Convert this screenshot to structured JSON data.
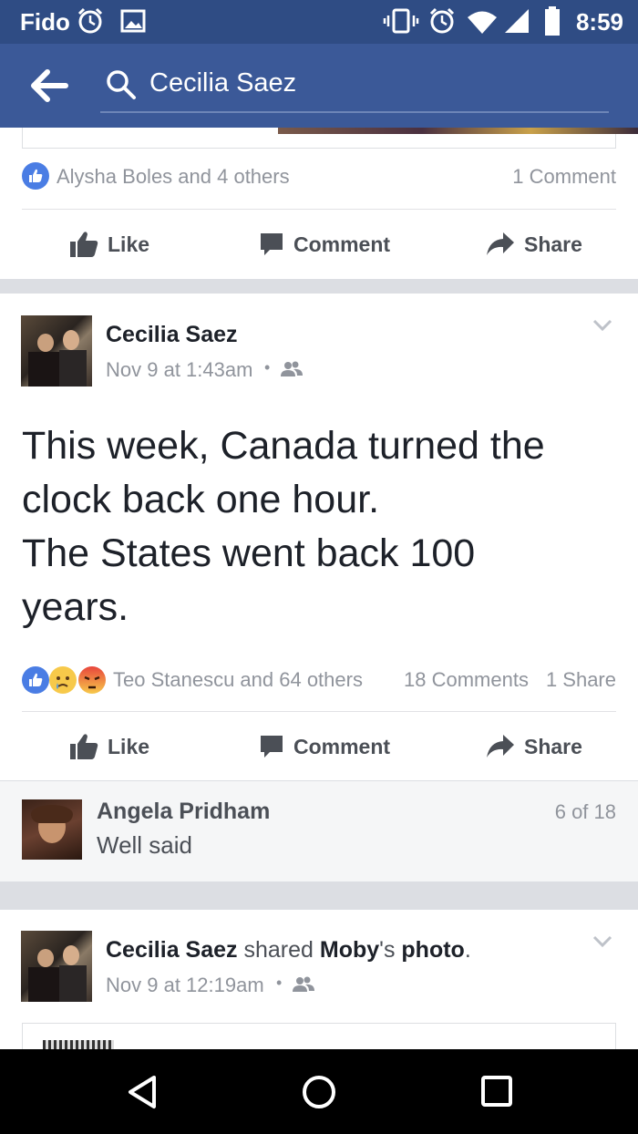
{
  "status_bar": {
    "carrier": "Fido",
    "time": "8:59"
  },
  "app_bar": {
    "search_text": "Cecilia Saez"
  },
  "post1": {
    "reactions_text": "Alysha Boles and 4 others",
    "comments_text": "1 Comment"
  },
  "actions": {
    "like": "Like",
    "comment": "Comment",
    "share": "Share"
  },
  "post2": {
    "author": "Cecilia Saez",
    "date": "Nov 9 at 1:43am",
    "separator": "•",
    "body": [
      "This week, Canada turned the",
      "clock back one hour.",
      "The States went back 100",
      "years."
    ],
    "reactions_text": "Teo Stanescu and 64 others",
    "comments_text": "18 Comments",
    "shares_text": "1 Share"
  },
  "comment": {
    "author": "Angela Pridham",
    "text": "Well said",
    "counter": "6 of 18"
  },
  "post3": {
    "author": "Cecilia Saez",
    "shared_word": "shared",
    "owner": "Moby",
    "possessive": "'s",
    "object": "photo",
    "period": ".",
    "date": "Nov 9 at 12:19am",
    "separator": "•"
  },
  "colors": {
    "brand_blue": "#3b5998",
    "status_blue": "#2f4c84",
    "like_blue": "#4267b2",
    "muted_text": "#90949c"
  },
  "icons": [
    "arrow-left-icon",
    "search-icon",
    "like-badge-icon",
    "thumbs-up-icon",
    "comment-bubble-icon",
    "share-arrow-icon",
    "chevron-down-icon",
    "friends-audience-icon",
    "sad-reaction-icon",
    "angry-reaction-icon",
    "back-triangle-icon",
    "home-circle-icon",
    "recents-square-icon"
  ]
}
